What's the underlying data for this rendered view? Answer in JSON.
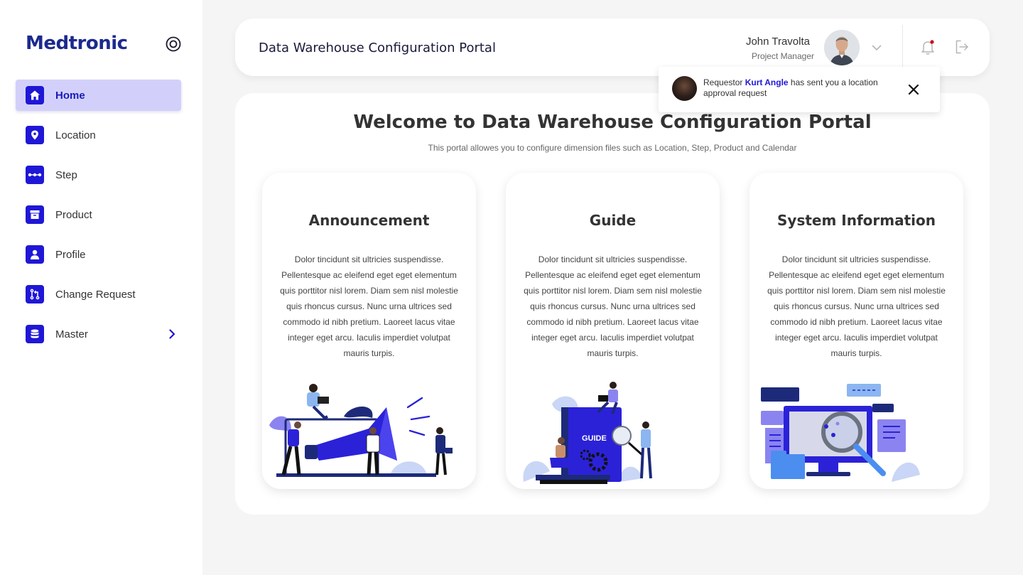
{
  "brand": {
    "name": "Medtronic"
  },
  "sidebar": {
    "items": [
      {
        "label": "Home",
        "icon": "home-icon",
        "active": true
      },
      {
        "label": "Location",
        "icon": "location-pin-icon"
      },
      {
        "label": "Step",
        "icon": "step-dots-icon"
      },
      {
        "label": "Product",
        "icon": "box-icon"
      },
      {
        "label": "Profile",
        "icon": "person-icon"
      },
      {
        "label": "Change Request",
        "icon": "pull-request-icon"
      },
      {
        "label": "Master",
        "icon": "database-icon",
        "has_submenu": true
      }
    ]
  },
  "header": {
    "title": "Data Warehouse Configuration Portal",
    "user": {
      "name": "John Travolta",
      "role": "Project Manager"
    }
  },
  "notification": {
    "prefix": "Requestor ",
    "requestor": "Kurt Angle",
    "message": " has sent you a location approval request"
  },
  "main": {
    "welcome": "Welcome to Data Warehouse Configuration Portal",
    "subtitle": "This portal allowes you to configure dimension files such as Location, Step, Product and Calendar",
    "cards": [
      {
        "title": "Announcement",
        "body": "Dolor tincidunt sit ultricies suspendisse. Pellentesque ac eleifend eget eget elementum quis porttitor nisl lorem. Diam sem nisl molestie quis rhoncus cursus. Nunc urna ultrices sed commodo id nibh pretium. Laoreet lacus vitae integer eget arcu. Iaculis imperdiet volutpat mauris turpis."
      },
      {
        "title": "Guide",
        "body": "Dolor tincidunt sit ultricies suspendisse. Pellentesque ac eleifend eget eget elementum quis porttitor nisl lorem. Diam sem nisl molestie quis rhoncus cursus. Nunc urna ultrices sed commodo id nibh pretium. Laoreet lacus vitae integer eget arcu. Iaculis imperdiet volutpat mauris turpis.",
        "illustration_label": "GUIDE"
      },
      {
        "title": "System Information",
        "body": "Dolor tincidunt sit ultricies suspendisse. Pellentesque ac eleifend eget eget elementum quis porttitor nisl lorem. Diam sem nisl molestie quis rhoncus cursus. Nunc urna ultrices sed commodo id nibh pretium. Laoreet lacus vitae integer eget arcu. Iaculis imperdiet volutpat mauris turpis."
      }
    ]
  },
  "colors": {
    "accent": "#1f17d6",
    "active_bg": "#d2d0fb",
    "brand": "#1c2a8f",
    "illustration_light": "#c9d6f5",
    "illustration_mid": "#8b84f0",
    "notification_dot": "#d0021b"
  }
}
